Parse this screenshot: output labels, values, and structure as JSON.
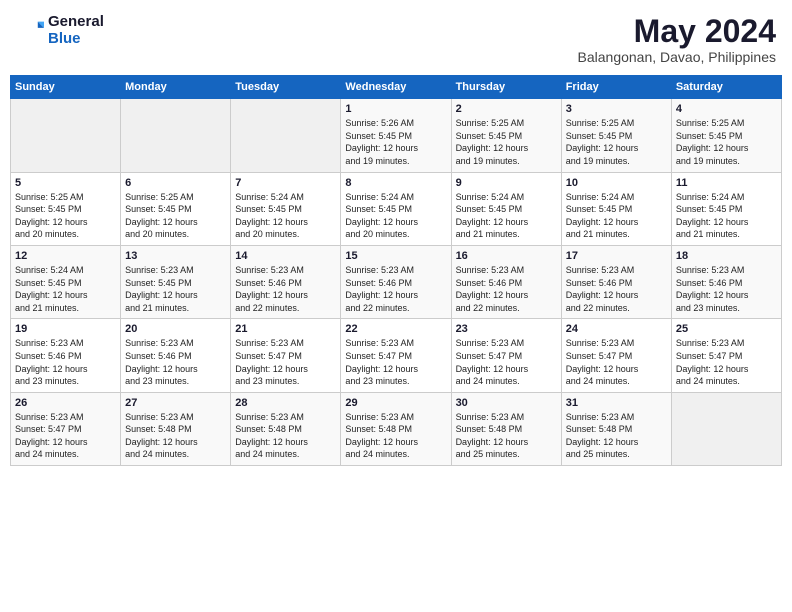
{
  "header": {
    "logo_general": "General",
    "logo_blue": "Blue",
    "month_year": "May 2024",
    "location": "Balangonan, Davao, Philippines"
  },
  "weekdays": [
    "Sunday",
    "Monday",
    "Tuesday",
    "Wednesday",
    "Thursday",
    "Friday",
    "Saturday"
  ],
  "weeks": [
    [
      {
        "day": "",
        "info": ""
      },
      {
        "day": "",
        "info": ""
      },
      {
        "day": "",
        "info": ""
      },
      {
        "day": "1",
        "info": "Sunrise: 5:26 AM\nSunset: 5:45 PM\nDaylight: 12 hours\nand 19 minutes."
      },
      {
        "day": "2",
        "info": "Sunrise: 5:25 AM\nSunset: 5:45 PM\nDaylight: 12 hours\nand 19 minutes."
      },
      {
        "day": "3",
        "info": "Sunrise: 5:25 AM\nSunset: 5:45 PM\nDaylight: 12 hours\nand 19 minutes."
      },
      {
        "day": "4",
        "info": "Sunrise: 5:25 AM\nSunset: 5:45 PM\nDaylight: 12 hours\nand 19 minutes."
      }
    ],
    [
      {
        "day": "5",
        "info": "Sunrise: 5:25 AM\nSunset: 5:45 PM\nDaylight: 12 hours\nand 20 minutes."
      },
      {
        "day": "6",
        "info": "Sunrise: 5:25 AM\nSunset: 5:45 PM\nDaylight: 12 hours\nand 20 minutes."
      },
      {
        "day": "7",
        "info": "Sunrise: 5:24 AM\nSunset: 5:45 PM\nDaylight: 12 hours\nand 20 minutes."
      },
      {
        "day": "8",
        "info": "Sunrise: 5:24 AM\nSunset: 5:45 PM\nDaylight: 12 hours\nand 20 minutes."
      },
      {
        "day": "9",
        "info": "Sunrise: 5:24 AM\nSunset: 5:45 PM\nDaylight: 12 hours\nand 21 minutes."
      },
      {
        "day": "10",
        "info": "Sunrise: 5:24 AM\nSunset: 5:45 PM\nDaylight: 12 hours\nand 21 minutes."
      },
      {
        "day": "11",
        "info": "Sunrise: 5:24 AM\nSunset: 5:45 PM\nDaylight: 12 hours\nand 21 minutes."
      }
    ],
    [
      {
        "day": "12",
        "info": "Sunrise: 5:24 AM\nSunset: 5:45 PM\nDaylight: 12 hours\nand 21 minutes."
      },
      {
        "day": "13",
        "info": "Sunrise: 5:23 AM\nSunset: 5:45 PM\nDaylight: 12 hours\nand 21 minutes."
      },
      {
        "day": "14",
        "info": "Sunrise: 5:23 AM\nSunset: 5:46 PM\nDaylight: 12 hours\nand 22 minutes."
      },
      {
        "day": "15",
        "info": "Sunrise: 5:23 AM\nSunset: 5:46 PM\nDaylight: 12 hours\nand 22 minutes."
      },
      {
        "day": "16",
        "info": "Sunrise: 5:23 AM\nSunset: 5:46 PM\nDaylight: 12 hours\nand 22 minutes."
      },
      {
        "day": "17",
        "info": "Sunrise: 5:23 AM\nSunset: 5:46 PM\nDaylight: 12 hours\nand 22 minutes."
      },
      {
        "day": "18",
        "info": "Sunrise: 5:23 AM\nSunset: 5:46 PM\nDaylight: 12 hours\nand 23 minutes."
      }
    ],
    [
      {
        "day": "19",
        "info": "Sunrise: 5:23 AM\nSunset: 5:46 PM\nDaylight: 12 hours\nand 23 minutes."
      },
      {
        "day": "20",
        "info": "Sunrise: 5:23 AM\nSunset: 5:46 PM\nDaylight: 12 hours\nand 23 minutes."
      },
      {
        "day": "21",
        "info": "Sunrise: 5:23 AM\nSunset: 5:47 PM\nDaylight: 12 hours\nand 23 minutes."
      },
      {
        "day": "22",
        "info": "Sunrise: 5:23 AM\nSunset: 5:47 PM\nDaylight: 12 hours\nand 23 minutes."
      },
      {
        "day": "23",
        "info": "Sunrise: 5:23 AM\nSunset: 5:47 PM\nDaylight: 12 hours\nand 24 minutes."
      },
      {
        "day": "24",
        "info": "Sunrise: 5:23 AM\nSunset: 5:47 PM\nDaylight: 12 hours\nand 24 minutes."
      },
      {
        "day": "25",
        "info": "Sunrise: 5:23 AM\nSunset: 5:47 PM\nDaylight: 12 hours\nand 24 minutes."
      }
    ],
    [
      {
        "day": "26",
        "info": "Sunrise: 5:23 AM\nSunset: 5:47 PM\nDaylight: 12 hours\nand 24 minutes."
      },
      {
        "day": "27",
        "info": "Sunrise: 5:23 AM\nSunset: 5:48 PM\nDaylight: 12 hours\nand 24 minutes."
      },
      {
        "day": "28",
        "info": "Sunrise: 5:23 AM\nSunset: 5:48 PM\nDaylight: 12 hours\nand 24 minutes."
      },
      {
        "day": "29",
        "info": "Sunrise: 5:23 AM\nSunset: 5:48 PM\nDaylight: 12 hours\nand 24 minutes."
      },
      {
        "day": "30",
        "info": "Sunrise: 5:23 AM\nSunset: 5:48 PM\nDaylight: 12 hours\nand 25 minutes."
      },
      {
        "day": "31",
        "info": "Sunrise: 5:23 AM\nSunset: 5:48 PM\nDaylight: 12 hours\nand 25 minutes."
      },
      {
        "day": "",
        "info": ""
      }
    ]
  ]
}
